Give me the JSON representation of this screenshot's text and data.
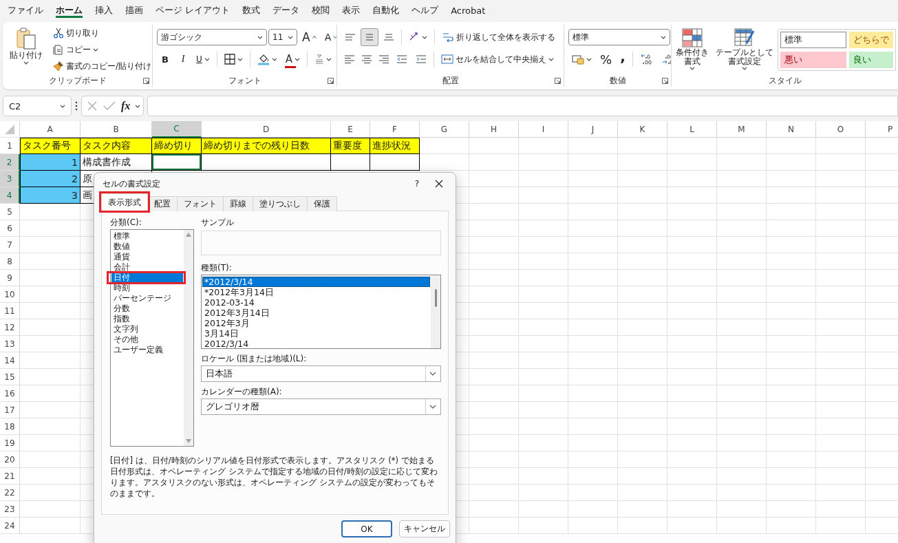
{
  "menu_tabs": [
    {
      "label": "ファイル",
      "selected": false
    },
    {
      "label": "ホーム",
      "selected": true
    },
    {
      "label": "挿入",
      "selected": false
    },
    {
      "label": "描画",
      "selected": false
    },
    {
      "label": "ページ レイアウト",
      "selected": false
    },
    {
      "label": "数式",
      "selected": false
    },
    {
      "label": "データ",
      "selected": false
    },
    {
      "label": "校閲",
      "selected": false
    },
    {
      "label": "表示",
      "selected": false
    },
    {
      "label": "自動化",
      "selected": false
    },
    {
      "label": "ヘルプ",
      "selected": false
    },
    {
      "label": "Acrobat",
      "selected": false
    }
  ],
  "clipboard": {
    "label": "クリップボード",
    "paste": "貼り付け",
    "cut": "切り取り",
    "copy": "コピー",
    "format_painter": "書式のコピー/貼り付け"
  },
  "font": {
    "label": "フォント",
    "font_name": "游ゴシック",
    "font_size": "11",
    "grow": "A",
    "shrink": "A",
    "bold": "B",
    "italic": "I",
    "underline": "U",
    "font_color": "A"
  },
  "alignment": {
    "label": "配置",
    "vertical": [
      {
        "selected": false
      },
      {
        "selected": true
      },
      {
        "selected": false
      }
    ],
    "wrap_text": "折り返して全体を表示する",
    "merge_center": "セルを結合して中央揃え"
  },
  "number": {
    "label": "数値",
    "format": "標準",
    "percent": "%",
    "comma": ","
  },
  "styles": {
    "label": "スタイル",
    "conditional": [
      "条件付き",
      "書式"
    ],
    "table": [
      "テーブルとして",
      "書式設定"
    ],
    "cells": [
      {
        "label": "標準",
        "kind": "normal"
      },
      {
        "label": "どちらで",
        "kind": "neutral"
      },
      {
        "label": "悪い",
        "kind": "bad"
      },
      {
        "label": "良い",
        "kind": "good"
      }
    ]
  },
  "formula_bar": {
    "name_box": "C2",
    "fx": "fx"
  },
  "sheet": {
    "columns": [
      {
        "label": "A",
        "selected": false
      },
      {
        "label": "B",
        "selected": false
      },
      {
        "label": "C",
        "selected": true
      },
      {
        "label": "D",
        "selected": false
      },
      {
        "label": "E",
        "selected": false
      },
      {
        "label": "F",
        "selected": false
      },
      {
        "label": "G",
        "selected": false
      },
      {
        "label": "H",
        "selected": false
      },
      {
        "label": "I",
        "selected": false
      },
      {
        "label": "J",
        "selected": false
      },
      {
        "label": "K",
        "selected": false
      },
      {
        "label": "L",
        "selected": false
      },
      {
        "label": "M",
        "selected": false
      },
      {
        "label": "N",
        "selected": false
      },
      {
        "label": "O",
        "selected": false
      },
      {
        "label": "P",
        "selected": false
      }
    ],
    "rows": [
      {
        "label": "1",
        "selected": false,
        "cells": [
          {
            "text": "タスク番号",
            "kind": "header",
            "active": false
          },
          {
            "text": "タスク内容",
            "kind": "header",
            "active": false
          },
          {
            "text": "締め切り",
            "kind": "header",
            "active": false
          },
          {
            "text": "締め切りまでの残り日数",
            "kind": "header",
            "active": false
          },
          {
            "text": "重要度",
            "kind": "header",
            "active": false
          },
          {
            "text": "進捗状況",
            "kind": "header",
            "active": false
          }
        ]
      },
      {
        "label": "2",
        "selected": true,
        "cells": [
          {
            "text": "1",
            "kind": "highlight",
            "active": false
          },
          {
            "text": "構成書作成",
            "kind": "plain",
            "active": false
          },
          {
            "kind": "plain",
            "active": true
          },
          {
            "kind": "plain",
            "active": false
          },
          {
            "kind": "plain",
            "active": false
          },
          {
            "kind": "plain",
            "active": false
          }
        ]
      },
      {
        "label": "3",
        "selected": true,
        "cells": [
          {
            "text": "2",
            "kind": "highlight",
            "active": false
          },
          {
            "text": "原",
            "kind": "plain",
            "active": false
          }
        ]
      },
      {
        "label": "4",
        "selected": true,
        "cells": [
          {
            "text": "3",
            "kind": "highlight",
            "active": false
          },
          {
            "text": "画",
            "kind": "plain",
            "active": false
          }
        ]
      },
      {
        "label": "5",
        "selected": false
      },
      {
        "label": "6",
        "selected": false
      },
      {
        "label": "7",
        "selected": false
      },
      {
        "label": "8",
        "selected": false
      },
      {
        "label": "9",
        "selected": false
      },
      {
        "label": "10",
        "selected": false
      },
      {
        "label": "11",
        "selected": false
      },
      {
        "label": "12",
        "selected": false
      },
      {
        "label": "13",
        "selected": false
      },
      {
        "label": "14",
        "selected": false
      },
      {
        "label": "15",
        "selected": false
      },
      {
        "label": "16",
        "selected": false
      },
      {
        "label": "17",
        "selected": false
      },
      {
        "label": "18",
        "selected": false
      },
      {
        "label": "19",
        "selected": false
      },
      {
        "label": "20",
        "selected": false
      },
      {
        "label": "21",
        "selected": false
      },
      {
        "label": "22",
        "selected": false
      },
      {
        "label": "23",
        "selected": false
      },
      {
        "label": "24",
        "selected": false
      }
    ]
  },
  "dialog": {
    "title": "セルの書式設定",
    "help": "?",
    "tabs": [
      {
        "label": "表示形式",
        "selected": true,
        "highlighted": true
      },
      {
        "label": "配置",
        "selected": false,
        "highlighted": false
      },
      {
        "label": "フォント",
        "selected": false,
        "highlighted": false
      },
      {
        "label": "罫線",
        "selected": false,
        "highlighted": false
      },
      {
        "label": "塗りつぶし",
        "selected": false,
        "highlighted": false
      },
      {
        "label": "保護",
        "selected": false,
        "highlighted": false
      }
    ],
    "category_label": "分類(C):",
    "categories": [
      {
        "label": "標準",
        "selected": false,
        "highlighted": false
      },
      {
        "label": "数値",
        "selected": false,
        "highlighted": false
      },
      {
        "label": "通貨",
        "selected": false,
        "highlighted": false
      },
      {
        "label": "会計",
        "selected": false,
        "highlighted": false
      },
      {
        "label": "日付",
        "selected": true,
        "highlighted": true
      },
      {
        "label": "時刻",
        "selected": false,
        "highlighted": false
      },
      {
        "label": "パーセンテージ",
        "selected": false,
        "highlighted": false
      },
      {
        "label": "分数",
        "selected": false,
        "highlighted": false
      },
      {
        "label": "指数",
        "selected": false,
        "highlighted": false
      },
      {
        "label": "文字列",
        "selected": false,
        "highlighted": false
      },
      {
        "label": "その他",
        "selected": false,
        "highlighted": false
      },
      {
        "label": "ユーザー定義",
        "selected": false,
        "highlighted": false
      }
    ],
    "sample_label": "サンプル",
    "type_label": "種類(T):",
    "types": [
      {
        "label": "*2012/3/14",
        "selected": true
      },
      {
        "label": "*2012年3月14日",
        "selected": false
      },
      {
        "label": "2012-03-14",
        "selected": false
      },
      {
        "label": "2012年3月14日",
        "selected": false
      },
      {
        "label": "2012年3月",
        "selected": false
      },
      {
        "label": "3月14日",
        "selected": false
      },
      {
        "label": "2012/3/14",
        "selected": false
      }
    ],
    "locale_label": "ロケール (国または地域)(L):",
    "locale": "日本語",
    "calendar_label": "カレンダーの種類(A):",
    "calendar": "グレゴリオ暦",
    "description": "[日付] は、日付/時刻のシリアル値を日付形式で表示します。アスタリスク (*) で始まる日付形式は、オペレーティング システムで指定する地域の日付/時刻の設定に応じて変わります。アスタリスクのない形式は、オペレーティング システムの設定が変わってもそのままです。",
    "buttons": [
      {
        "label": "OK",
        "kind": "primary"
      },
      {
        "label": "キャンセル",
        "kind": "secondary"
      }
    ]
  }
}
